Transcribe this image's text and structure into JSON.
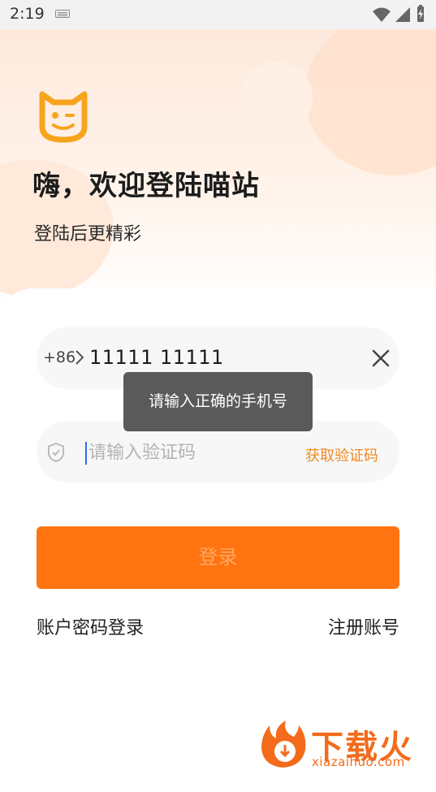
{
  "status_bar": {
    "time": "2:19",
    "icons": [
      "keyboard-icon",
      "wifi-icon",
      "signal-icon",
      "battery-charging-icon"
    ]
  },
  "header": {
    "title": "嗨，欢迎登陆喵站",
    "subtitle": "登陆后更精彩"
  },
  "phone": {
    "country_code": "+86",
    "value": "11111 11111"
  },
  "code": {
    "placeholder": "请输入验证码",
    "get_code_label": "获取验证码"
  },
  "toast": {
    "message": "请输入正确的手机号"
  },
  "login_button": {
    "label": "登录"
  },
  "links": {
    "password_login": "账户密码登录",
    "register": "注册账号"
  },
  "watermark": {
    "brand": "下载火",
    "url": "xiazaihuo.com"
  },
  "colors": {
    "accent": "#ff7410",
    "link_orange": "#f08a24",
    "logo_yellow": "#f7a41d",
    "toast_bg": "#5a5a5a"
  }
}
